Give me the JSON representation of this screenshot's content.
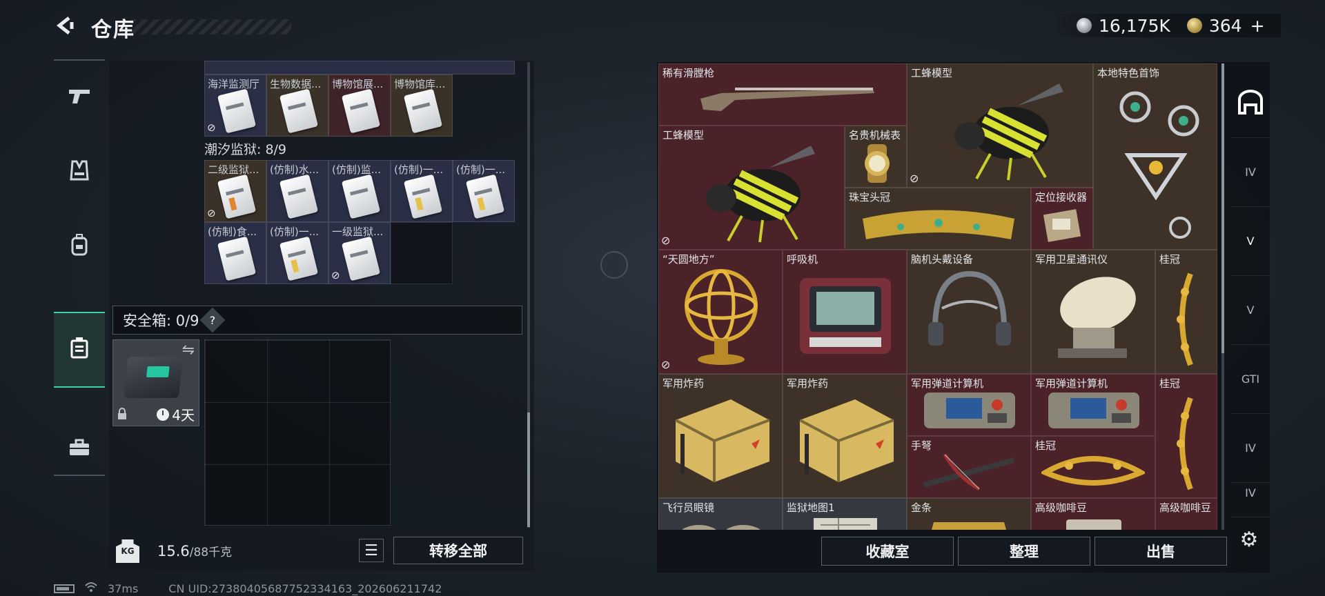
{
  "header": {
    "title": "仓库",
    "currency_silver": "16,175K",
    "currency_gold": "364",
    "gold_add": "+"
  },
  "leftnav": {
    "items": [
      {
        "name": "weapons",
        "icon": "pistol-icon"
      },
      {
        "name": "armor",
        "icon": "vest-icon"
      },
      {
        "name": "backpack",
        "icon": "backpack-icon"
      },
      {
        "name": "container",
        "icon": "container-icon",
        "active": true
      },
      {
        "name": "toolbox",
        "icon": "toolbox-icon"
      }
    ]
  },
  "inventory": {
    "top_row": [
      "海洋监测厅",
      "生物数据...",
      "博物馆展...",
      "博物馆库..."
    ],
    "section_label": "潮汐监狱: 8/9",
    "row_a": [
      "二级监狱...",
      "(仿制)水...",
      "(仿制)监...",
      "(仿制)一...",
      "(仿制)一..."
    ],
    "row_b": [
      "(仿制)食...",
      "(仿制)一...",
      "一级监狱..."
    ]
  },
  "safebox": {
    "label": "安全箱: 0/9",
    "help": "?",
    "timer": "4天"
  },
  "footer_left": {
    "weight_current": "15.6",
    "weight_max": "/88千克",
    "weight_icon_text": "KG",
    "transfer_label": "转移全部"
  },
  "stash": {
    "items": [
      {
        "label": "稀有滑膛枪"
      },
      {
        "label": "工蜂模型"
      },
      {
        "label": "本地特色首饰"
      },
      {
        "label": "工蜂模型"
      },
      {
        "label": "名贵机械表"
      },
      {
        "label": "珠宝头冠"
      },
      {
        "label": "定位接收器"
      },
      {
        "label": "“天圆地方”"
      },
      {
        "label": "呼吸机"
      },
      {
        "label": "脑机头戴设备"
      },
      {
        "label": "军用卫星通讯仪"
      },
      {
        "label": "桂冠"
      },
      {
        "label": "军用炸药"
      },
      {
        "label": "军用炸药"
      },
      {
        "label": "军用弹道计算机"
      },
      {
        "label": "军用弹道计算机"
      },
      {
        "label": "桂冠"
      },
      {
        "label": "手弩"
      },
      {
        "label": "桂冠"
      },
      {
        "label": "飞行员眼镜"
      },
      {
        "label": "监狱地图1"
      },
      {
        "label": "金条"
      },
      {
        "label": "高级咖啡豆"
      },
      {
        "label": "高级咖啡豆"
      }
    ]
  },
  "rightnav": {
    "tabs": [
      {
        "icon": "main-stash-icon",
        "label": ""
      },
      {
        "icon": "IV",
        "label": "IV"
      },
      {
        "icon": "V",
        "label": "V"
      },
      {
        "icon": "V",
        "label": "V"
      },
      {
        "icon": "GTI",
        "label": "GTI"
      },
      {
        "icon": "IV",
        "label": "IV"
      },
      {
        "icon": "IV",
        "label": "IV"
      }
    ]
  },
  "footer_right": {
    "collection_label": "收藏室",
    "sort_label": "整理",
    "sell_label": "出售"
  },
  "status": {
    "ping": "37ms",
    "uid": "CN UID:273804056877523341​63_202606211742"
  }
}
